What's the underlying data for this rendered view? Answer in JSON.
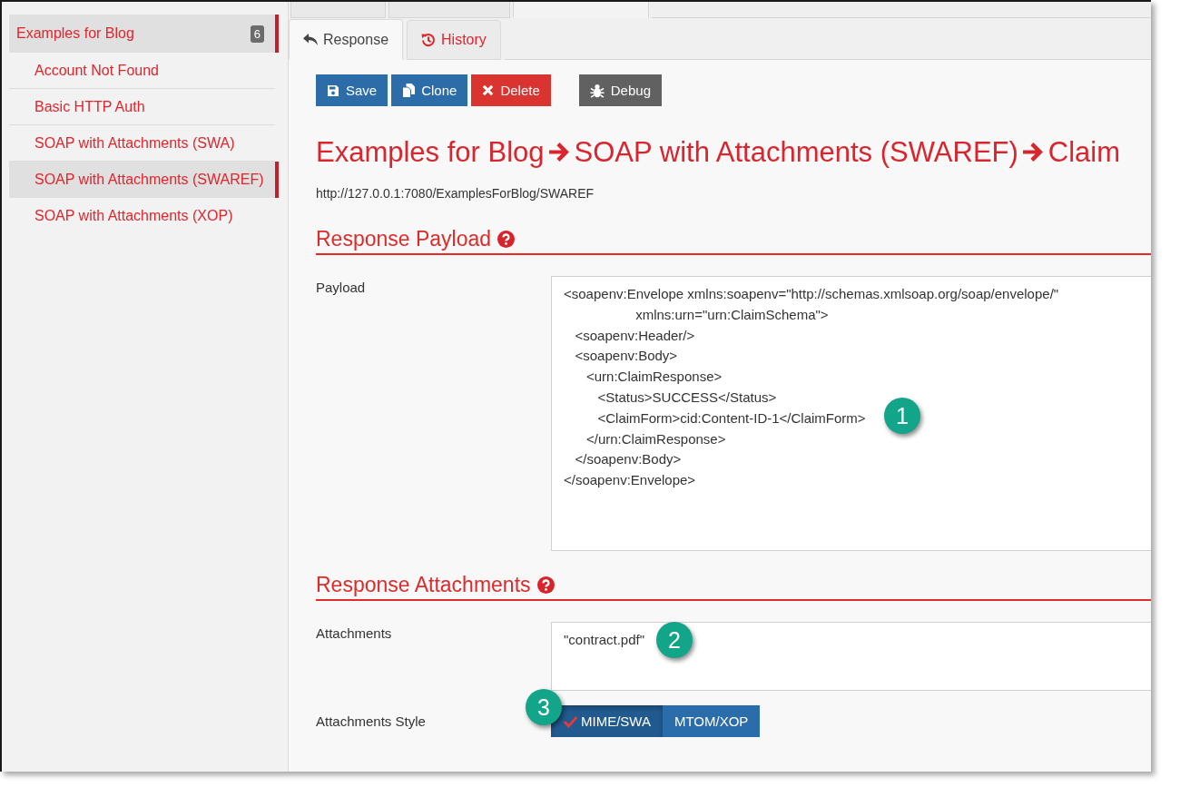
{
  "sidebar": {
    "items": [
      {
        "label": "Examples for Blog",
        "count": "6",
        "selected": true,
        "children": [
          {
            "label": "Account Not Found",
            "selected": false
          },
          {
            "label": "Basic HTTP Auth",
            "selected": false
          },
          {
            "label": "SOAP with Attachments (SWA)",
            "selected": false
          },
          {
            "label": "SOAP with Attachments (SWAREF)",
            "selected": true
          },
          {
            "label": "SOAP with Attachments (XOP)",
            "selected": false
          }
        ]
      }
    ]
  },
  "top_tabs": [
    {
      "selected": false
    },
    {
      "selected": false
    },
    {
      "selected": true
    }
  ],
  "tabs": [
    {
      "label": "Response",
      "kind": "reply",
      "selected": true
    },
    {
      "label": "History",
      "kind": "history",
      "selected": false
    }
  ],
  "toolbar": [
    {
      "label": "Save",
      "kind": "save"
    },
    {
      "label": "Clone",
      "kind": "clone"
    },
    {
      "label": "Delete",
      "kind": "delete"
    },
    {
      "label": "Debug",
      "kind": "debug"
    }
  ],
  "breadcrumb": [
    "Examples for Blog",
    "SOAP with Attachments (SWAREF)",
    "Claim"
  ],
  "url": "http://127.0.0.1:7080/ExamplesForBlog/SWAREF",
  "sections": [
    {
      "title": "Response Payload",
      "fields": [
        {
          "label": "Payload",
          "kind": "textarea",
          "value": "<soapenv:Envelope xmlns:soapenv=\"http://schemas.xmlsoap.org/soap/envelope/\"\n                   xmlns:urn=\"urn:ClaimSchema\">\n   <soapenv:Header/>\n   <soapenv:Body>\n      <urn:ClaimResponse>\n         <Status>SUCCESS</Status>\n         <ClaimForm>cid:Content-ID-1</ClaimForm>\n      </urn:ClaimResponse>\n   </soapenv:Body>\n</soapenv:Envelope>",
          "callout": "1"
        }
      ]
    },
    {
      "title": "Response Attachments",
      "fields": [
        {
          "label": "Attachments",
          "kind": "textarea",
          "value": "\"contract.pdf\"",
          "callout": "2"
        },
        {
          "label": "Attachments Style",
          "kind": "toggle",
          "options": [
            {
              "label": "MIME/SWA",
              "selected": true
            },
            {
              "label": "MTOM/XOP",
              "selected": false
            }
          ],
          "callout": "3"
        }
      ]
    }
  ]
}
